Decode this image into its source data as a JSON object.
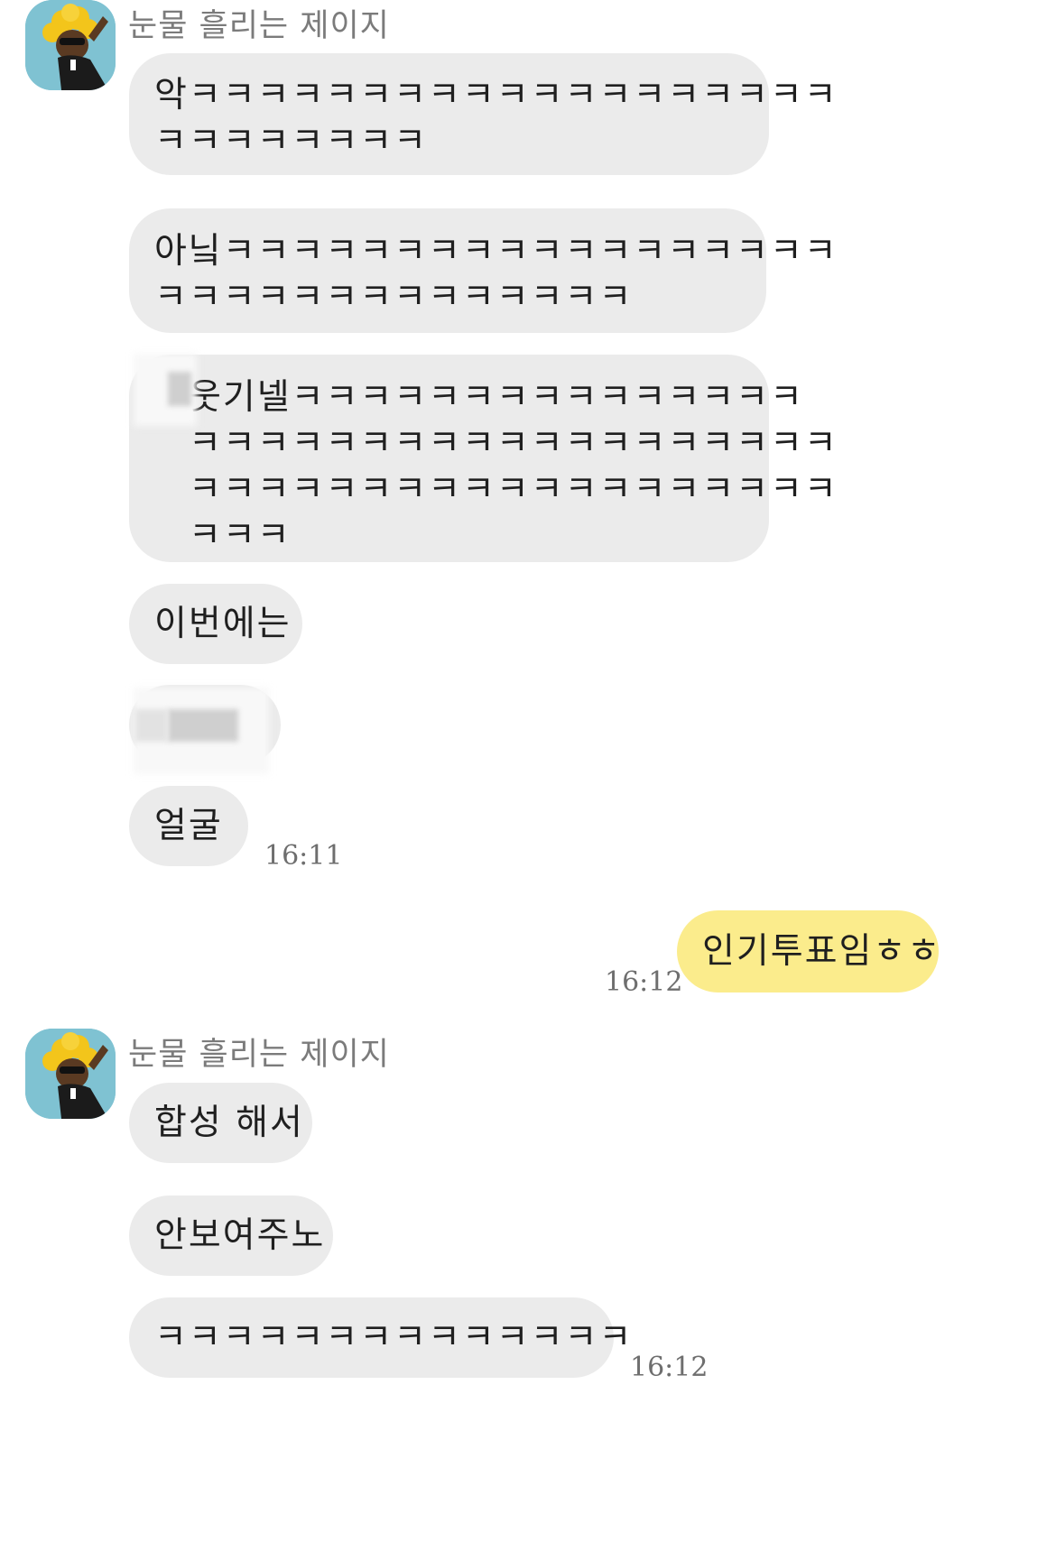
{
  "chat": {
    "sender_name": "눈물 흘리는 제이지",
    "messages": [
      {
        "text": "악ㅋㅋㅋㅋㅋㅋㅋㅋㅋㅋㅋㅋㅋㅋㅋㅋㅋㅋㅋ\nㅋㅋㅋㅋㅋㅋㅋㅋ"
      },
      {
        "text": "아닠ㅋㅋㅋㅋㅋㅋㅋㅋㅋㅋㅋㅋㅋㅋㅋㅋㅋㅋ\nㅋㅋㅋㅋㅋㅋㅋㅋㅋㅋㅋㅋㅋㅋ"
      },
      {
        "text": "웃기넬ㅋㅋㅋㅋㅋㅋㅋㅋㅋㅋㅋㅋㅋㅋㅋ\nㅋㅋㅋㅋㅋㅋㅋㅋㅋㅋㅋㅋㅋㅋㅋㅋㅋㅋㅋ\nㅋㅋㅋㅋㅋㅋㅋㅋㅋㅋㅋㅋㅋㅋㅋㅋㅋㅋㅋ\nㅋㅋㅋ"
      },
      {
        "text": "이번에는"
      },
      {
        "text": ""
      },
      {
        "text": "얼굴",
        "time": "16:11"
      }
    ],
    "my_message": {
      "text": "인기투표임ㅎㅎ",
      "time": "16:12"
    },
    "second_group": {
      "sender_name": "눈물 흘리는 제이지",
      "messages": [
        {
          "text": "합성 해서"
        },
        {
          "text": "안보여주노"
        },
        {
          "text": "ㅋㅋㅋㅋㅋㅋㅋㅋㅋㅋㅋㅋㅋㅋ",
          "time": "16:12"
        }
      ]
    }
  },
  "colors": {
    "their_bubble": "#ebebeb",
    "my_bubble": "#fbec8c",
    "avatar_bg": "#7fc2d2"
  },
  "icons": {
    "avatar": "ryan-jay-g-avatar-icon"
  }
}
